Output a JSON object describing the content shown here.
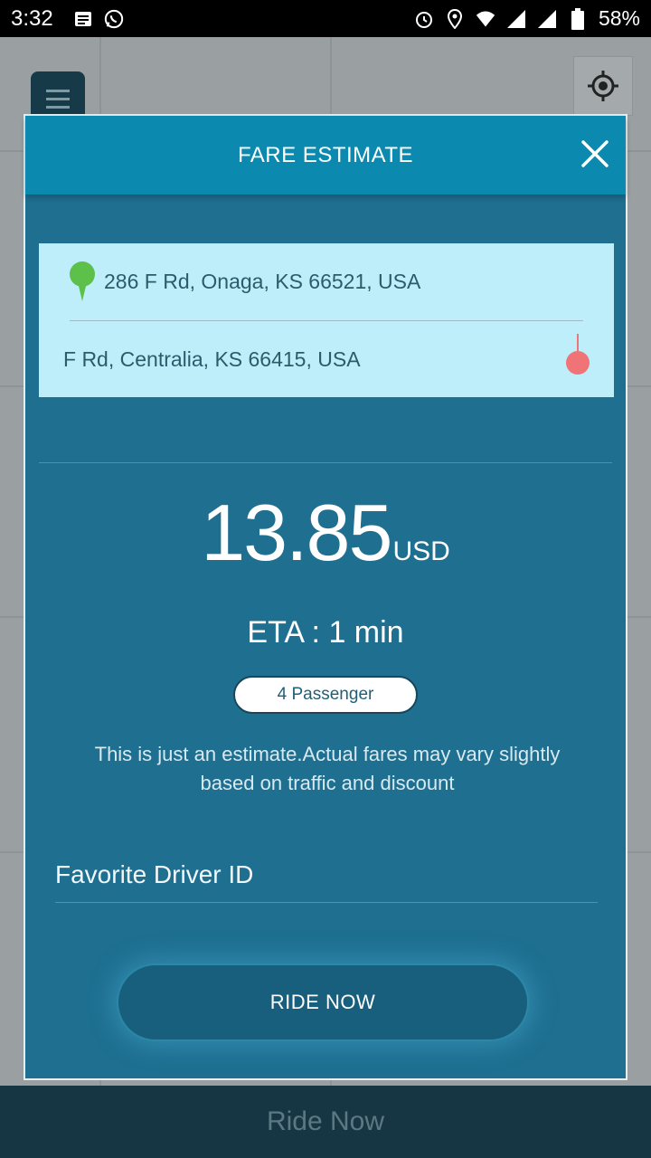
{
  "status_bar": {
    "time": "3:32",
    "battery": "58%",
    "left_icons": [
      "notes-icon",
      "whatsapp-icon"
    ],
    "right_icons": [
      "alarm-icon",
      "location-icon",
      "wifi-icon",
      "signal-icon",
      "signal-icon",
      "battery-icon"
    ]
  },
  "map": {
    "menu_icon": "hamburger-icon",
    "locate_icon": "crosshair-icon"
  },
  "modal": {
    "title": "FARE ESTIMATE",
    "close_icon": "close-icon",
    "pickup_address": "286 F Rd, Onaga, KS 66521, USA",
    "dropoff_address": "F Rd, Centralia, KS 66415, USA",
    "fare_value": "13.85",
    "fare_currency": "USD",
    "eta": "ETA : 1 min",
    "passenger": "4 Passenger",
    "note": "This is just an estimate.Actual fares may vary slightly based on traffic and discount",
    "driver_placeholder": "Favorite Driver ID",
    "ride_now_label": "RIDE NOW"
  },
  "bottom_bar": {
    "label": "Ride Now"
  },
  "colors": {
    "header": "#0b89ae",
    "modal_bg": "#1e6f90",
    "address_card": "#bfeefb",
    "pickup_pin": "#5cc04a",
    "dropoff_pin": "#f07377"
  }
}
